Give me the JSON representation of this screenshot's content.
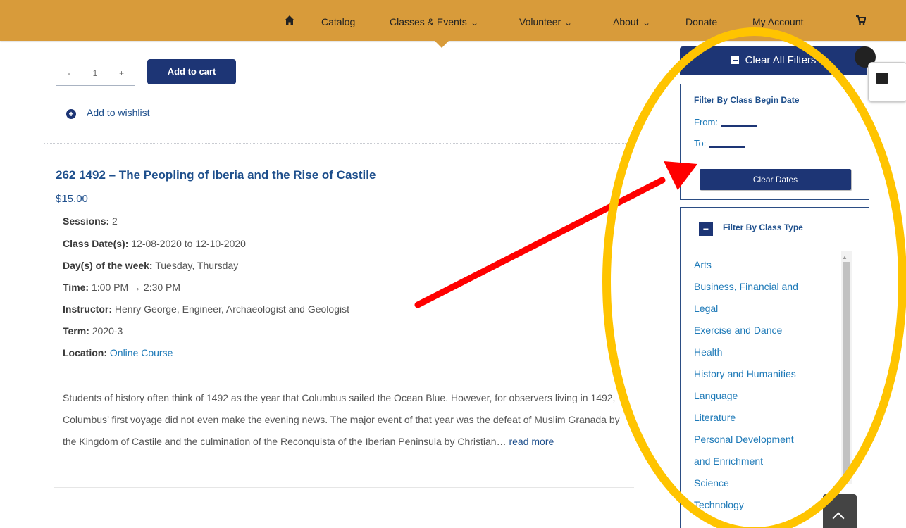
{
  "nav": {
    "home_icon": "home-icon",
    "items": [
      "Catalog",
      "Classes & Events",
      "Volunteer",
      "About",
      "Donate",
      "My Account"
    ],
    "chevron": "⌄",
    "cart_icon": "cart-icon"
  },
  "cart": {
    "qty_minus": "-",
    "qty_value": "1",
    "qty_plus": "+",
    "add_label": "Add to cart",
    "wishlist_label": "Add to wishlist"
  },
  "product": {
    "title": "262 1492 – The Peopling of Iberia and the Rise of Castile",
    "price": "$15.00",
    "details": [
      {
        "label": "Sessions:",
        "value": "2"
      },
      {
        "label": "Class Date(s):",
        "value": "12-08-2020 to 12-10-2020"
      },
      {
        "label": "Day(s) of the week:",
        "value": "Tuesday, Thursday"
      },
      {
        "label": "Time:",
        "value": "1:00 PM → 2:30 PM"
      },
      {
        "label": "Instructor:",
        "value": "Henry George, Engineer, Archaeologist and Geologist"
      },
      {
        "label": "Term:",
        "value": "2020-3"
      },
      {
        "label": "Location:",
        "value": "Online Course"
      }
    ],
    "description": "Students of history often think of 1492 as the year that Columbus sailed the Ocean Blue.  However, for observers living in 1492, Columbus’ first voyage did not even make the evening news.  The major event of that year was the defeat of Muslim Granada by the Kingdom of Castile and the culmination of the Reconquista of the Iberian Peninsula by Christian…",
    "read_more": "read more"
  },
  "sidebar": {
    "clear_all": "Clear All Filters",
    "date_filter": {
      "heading": "Filter By Class Begin Date",
      "from_label": "From:",
      "to_label": "To:",
      "clear_button": "Clear Dates"
    },
    "type_filter": {
      "toggle": "−",
      "heading": "Filter By Class Type",
      "items": [
        "Arts",
        "Business, Financial and",
        "Legal",
        "Exercise and Dance",
        "Health",
        "History and Humanities",
        "Language",
        "Literature",
        "Personal Development",
        "and Enrichment",
        "Science",
        "Technology"
      ]
    }
  },
  "annotations": {
    "arrow_color": "#ff0000",
    "circle_color": "#ffc400"
  }
}
